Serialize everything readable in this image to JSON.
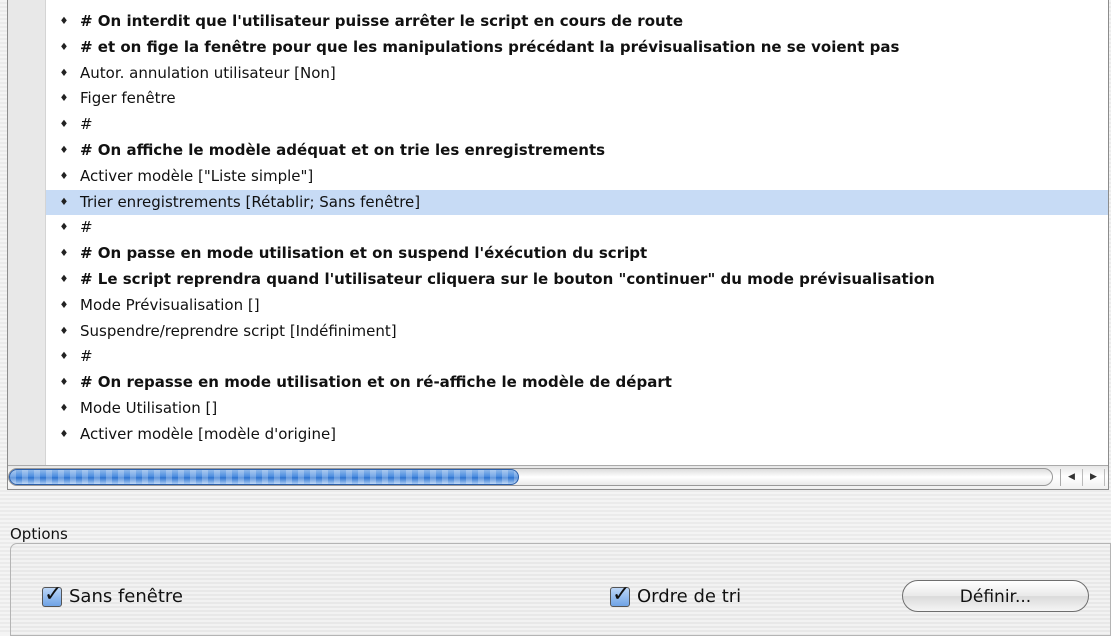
{
  "steps": [
    {
      "text": "# On interdit que l'utilisateur puisse arrêter le script en cours de route",
      "bold": true
    },
    {
      "text": "# et on fige la fenêtre pour que les manipulations précédant la prévisualisation ne se voient pas",
      "bold": true
    },
    {
      "text": "Autor. annulation utilisateur [Non]",
      "bold": false
    },
    {
      "text": "Figer fenêtre",
      "bold": false
    },
    {
      "text": "#",
      "bold": false
    },
    {
      "text": "# On affiche le modèle adéquat et on trie les enregistrements",
      "bold": true
    },
    {
      "text": "Activer modèle [\"Liste simple\"]",
      "bold": false
    },
    {
      "text": "Trier enregistrements [Rétablir; Sans fenêtre]",
      "bold": false,
      "selected": true
    },
    {
      "text": "#",
      "bold": false
    },
    {
      "text": "# On passe en mode utilisation et on suspend l'éxécution du script",
      "bold": true
    },
    {
      "text": "# Le script reprendra quand l'utilisateur cliquera sur le bouton \"continuer\" du mode prévisualisation",
      "bold": true
    },
    {
      "text": "Mode Prévisualisation []",
      "bold": false
    },
    {
      "text": "Suspendre/reprendre script [Indéfiniment]",
      "bold": false
    },
    {
      "text": "#",
      "bold": false
    },
    {
      "text": "# On repasse en mode utilisation et on ré-affiche le modèle de départ",
      "bold": true
    },
    {
      "text": "Mode Utilisation []",
      "bold": false
    },
    {
      "text": "Activer modèle [modèle d'origine]",
      "bold": false
    }
  ],
  "step_handle_icon": "updown-arrows-icon",
  "scroll": {
    "left_arrow": "◀",
    "right_arrow": "▶"
  },
  "options": {
    "title": "Options",
    "no_dialog_label": "Sans fenêtre",
    "no_dialog_checked": true,
    "sort_order_label": "Ordre de tri",
    "sort_order_checked": true,
    "define_button": "Définir..."
  },
  "colors": {
    "selection": "#c7dbf5",
    "accent": "#3b7fd8"
  }
}
